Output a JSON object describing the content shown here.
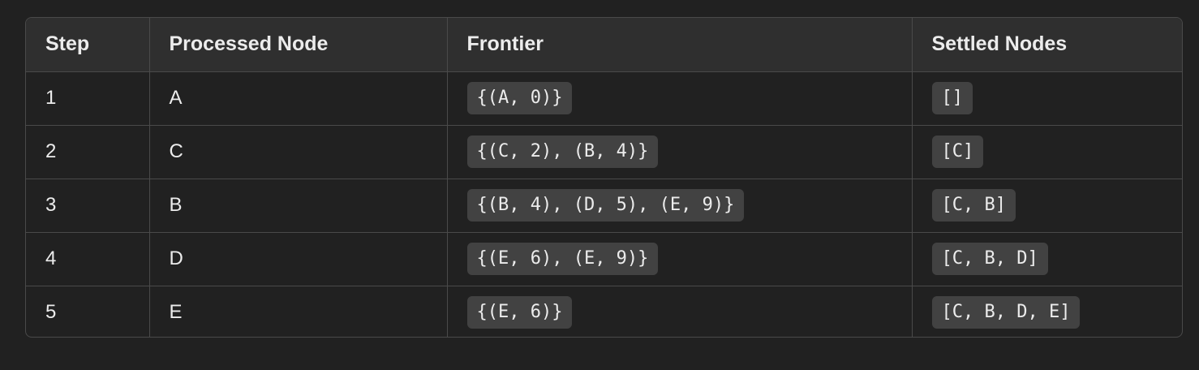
{
  "table": {
    "headers": [
      "Step",
      "Processed Node",
      "Frontier",
      "Settled Nodes"
    ],
    "rows": [
      {
        "step": "1",
        "node": "A",
        "frontier": "{(A, 0)}",
        "settled": "[]"
      },
      {
        "step": "2",
        "node": "C",
        "frontier": "{(C, 2), (B, 4)}",
        "settled": "[C]"
      },
      {
        "step": "3",
        "node": "B",
        "frontier": "{(B, 4), (D, 5), (E, 9)}",
        "settled": "[C, B]"
      },
      {
        "step": "4",
        "node": "D",
        "frontier": "{(E, 6), (E, 9)}",
        "settled": "[C, B, D]"
      },
      {
        "step": "5",
        "node": "E",
        "frontier": "{(E, 6)}",
        "settled": "[C, B, D, E]"
      }
    ]
  },
  "colors": {
    "background": "#212121",
    "header_background": "#2f2f2f",
    "border": "#4a4a4a",
    "code_background": "#424242",
    "text": "#ececec"
  }
}
